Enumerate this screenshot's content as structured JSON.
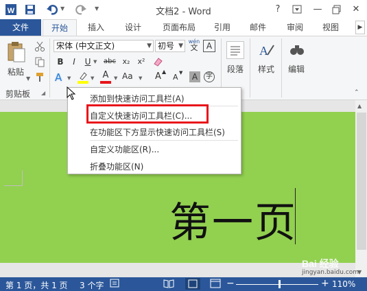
{
  "window": {
    "title": "文档2 - Word",
    "help": "?",
    "minimize": "—",
    "close": "✕"
  },
  "tabs": [
    "文件",
    "开始",
    "插入",
    "设计",
    "页面布局",
    "引用",
    "邮件",
    "审阅",
    "视图"
  ],
  "ribbon": {
    "clipboard_label": "剪贴板",
    "paste_label": "粘贴",
    "font_name": "宋体 (中文正文)",
    "font_size": "初号",
    "wen_label": "wén",
    "wen_char": "文",
    "bold": "B",
    "italic": "I",
    "underline": "U",
    "strike": "abc",
    "subscript": "x₂",
    "superscript": "x²",
    "text_effect": "A",
    "font_color": "A",
    "change_case": "Aa",
    "grow_font": "A",
    "shrink_font": "A",
    "char_shading": "A",
    "enclose_char": "字",
    "paragraph_label": "段落",
    "styles_label": "样式",
    "editing_label": "编辑"
  },
  "context_menu": {
    "items": [
      "添加到快速访问工具栏(A)",
      "自定义快速访问工具栏(C)...",
      "在功能区下方显示快速访问工具栏(S)",
      "自定义功能区(R)...",
      "折叠功能区(N)"
    ]
  },
  "document": {
    "text": "第一页"
  },
  "status_bar": {
    "page": "第 1 页，共 1 页",
    "words": "3 个字",
    "zoom": "110%"
  },
  "watermark": {
    "text": "Bai 经验",
    "url": "jingyan.baidu.com"
  },
  "colors": {
    "word_blue": "#2b579a",
    "page_green": "#92d050",
    "highlight_red": "#e8141a"
  }
}
